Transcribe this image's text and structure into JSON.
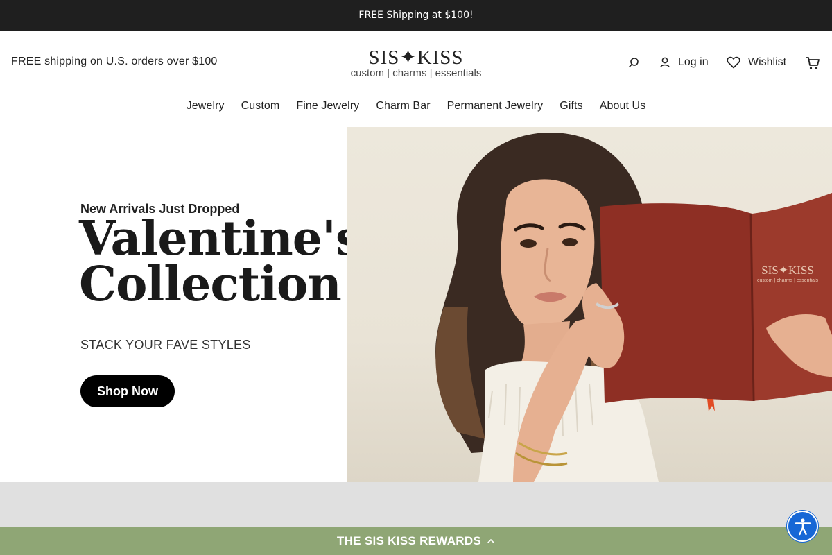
{
  "announcement": {
    "text": "FREE Shipping at $100!"
  },
  "header": {
    "shipping_note": "FREE shipping on U.S. orders over $100",
    "logo": {
      "main": "SIS✦KISS",
      "sub": "custom | charms | essentials"
    },
    "login_label": "Log in",
    "wishlist_label": "Wishlist"
  },
  "nav": {
    "items": [
      {
        "label": "Jewelry"
      },
      {
        "label": "Custom"
      },
      {
        "label": "Fine Jewelry"
      },
      {
        "label": "Charm Bar"
      },
      {
        "label": "Permanent Jewelry"
      },
      {
        "label": "Gifts"
      },
      {
        "label": "About Us"
      }
    ]
  },
  "hero": {
    "eyebrow": "New Arrivals Just Dropped",
    "headline": "Valentine's Collection",
    "subline": "STACK YOUR FAVE STYLES",
    "cta_label": "Shop Now",
    "book_logo": "SIS✦KISS",
    "book_logo_sub": "custom | charms | essentials"
  },
  "rewards": {
    "label": "THE SIS KISS REWARDS"
  },
  "icons": {
    "search": "search-icon",
    "account": "user-icon",
    "wishlist": "heart-icon",
    "cart": "cart-icon",
    "rewards": "chevron-up-icon",
    "accessibility": "accessibility-icon"
  },
  "colors": {
    "announcement_bg": "#1f1f1f",
    "cta_bg": "#000000",
    "rewards_bg": "#8fa675",
    "accessibility_bg": "#1667d6"
  }
}
